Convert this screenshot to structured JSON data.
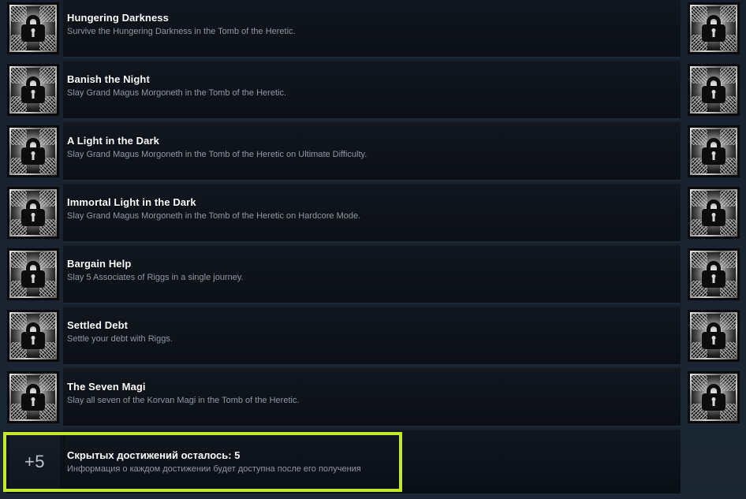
{
  "theme": {
    "page_background": "#1a2430",
    "row_background": "#0e1219",
    "title_color": "#ffffff",
    "description_color": "#8e9aa5",
    "highlight_border_color": "#c4e832"
  },
  "icons": {
    "locked_achievement": "locked-padlock-icon",
    "hidden_count_badge": "plus-count-badge"
  },
  "achievements": [
    {
      "title": "Hungering Darkness",
      "description": "Survive the Hungering Darkness in the Tomb of the Heretic.",
      "locked": true
    },
    {
      "title": "Banish the Night",
      "description": "Slay Grand Magus Morgoneth in the Tomb of the Heretic.",
      "locked": true
    },
    {
      "title": "A Light in the Dark",
      "description": "Slay Grand Magus Morgoneth in the Tomb of the Heretic on Ultimate Difficulty.",
      "locked": true
    },
    {
      "title": "Immortal Light in the Dark",
      "description": "Slay Grand Magus Morgoneth in the Tomb of the Heretic on Hardcore Mode.",
      "locked": true
    },
    {
      "title": "Bargain Help",
      "description": "Slay 5 Associates of Riggs in a single journey.",
      "locked": true
    },
    {
      "title": "Settled Debt",
      "description": "Settle your debt with Riggs.",
      "locked": true
    },
    {
      "title": "The Seven Magi",
      "description": "Slay all seven of the Korvan Magi in the Tomb of the Heretic.",
      "locked": true
    }
  ],
  "hidden_achievements": {
    "badge_label": "+5",
    "count": 5,
    "title": "Скрытых достижений осталось: 5",
    "description": "Информация о каждом достижении будет доступна после его получения",
    "highlighted": true
  }
}
